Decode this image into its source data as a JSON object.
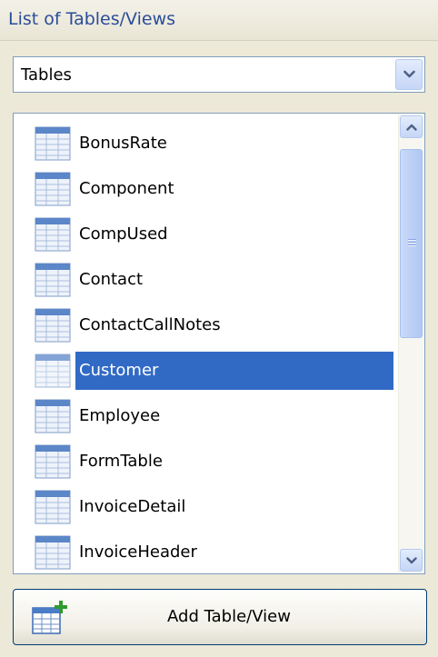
{
  "panel": {
    "title": "List of Tables/Views"
  },
  "combo": {
    "selected": "Tables",
    "button_icon": "chevron-down-icon"
  },
  "list": {
    "items": [
      {
        "label": "BonusRate",
        "icon": "table-icon",
        "selected": false
      },
      {
        "label": "Component",
        "icon": "table-icon",
        "selected": false
      },
      {
        "label": "CompUsed",
        "icon": "table-icon",
        "selected": false
      },
      {
        "label": "Contact",
        "icon": "table-icon",
        "selected": false
      },
      {
        "label": "ContactCallNotes",
        "icon": "table-icon",
        "selected": false
      },
      {
        "label": "Customer",
        "icon": "table-icon",
        "selected": true
      },
      {
        "label": "Employee",
        "icon": "table-icon",
        "selected": false
      },
      {
        "label": "FormTable",
        "icon": "table-icon",
        "selected": false
      },
      {
        "label": "InvoiceDetail",
        "icon": "table-icon",
        "selected": false
      },
      {
        "label": "InvoiceHeader",
        "icon": "table-icon",
        "selected": false
      }
    ]
  },
  "scrollbar": {
    "up_icon": "scroll-up-icon",
    "down_icon": "scroll-down-icon"
  },
  "add_button": {
    "label": "Add Table/View",
    "icon": "add-table-icon"
  },
  "colors": {
    "title": "#2b4c9a",
    "selection": "#316ac5",
    "panel_bg": "#ece9d8",
    "border": "#7f9db9"
  }
}
